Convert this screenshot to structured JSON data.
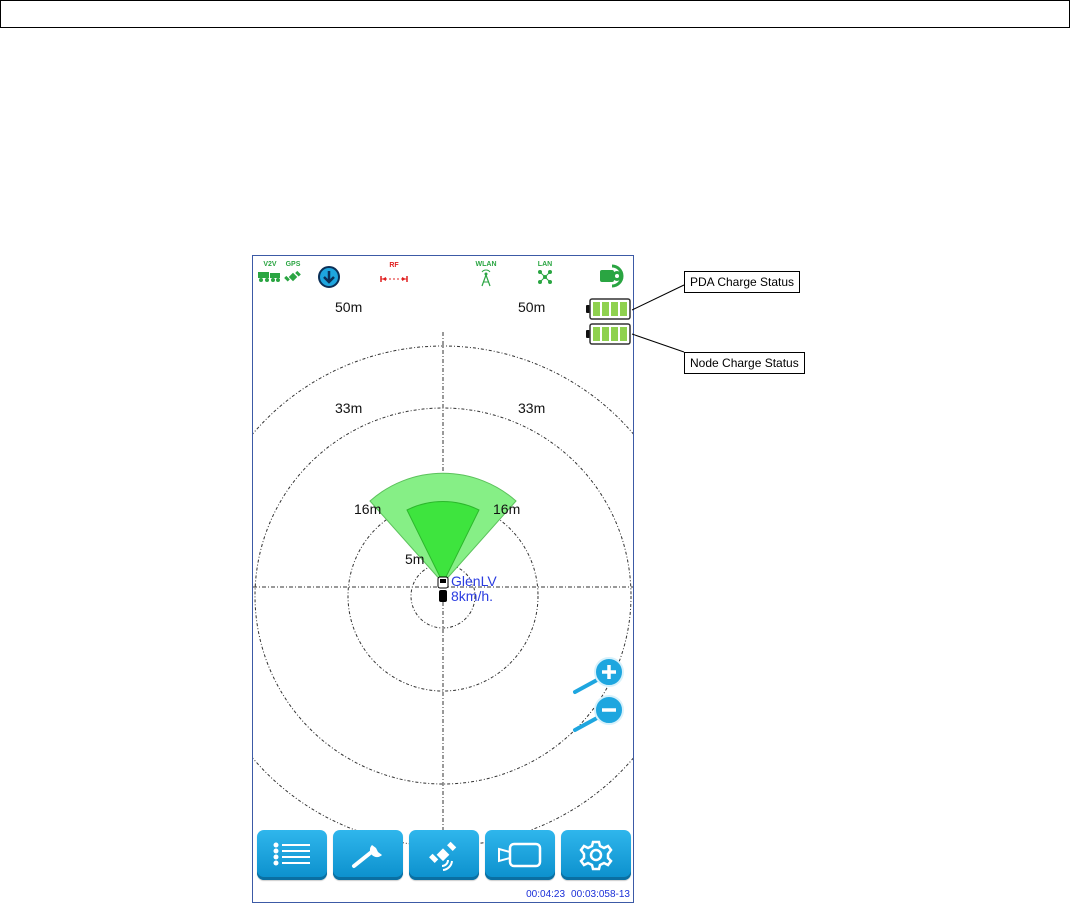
{
  "status_bar": {
    "v2v_label": "V2V",
    "gps_label": "GPS",
    "rf_label": "RF",
    "wlan_label": "WLAN",
    "lan_label": "LAN"
  },
  "radar": {
    "range_labels": {
      "outer_left": "50m",
      "outer_right": "50m",
      "r33_left": "33m",
      "r33_right": "33m",
      "r16_left": "16m",
      "r16_right": "16m",
      "r5": "5m"
    },
    "target": {
      "name": "GlenLV",
      "speed": "8km/h."
    }
  },
  "zoom": {
    "in_icon": "zoom-in-icon",
    "out_icon": "zoom-out-icon"
  },
  "toolbar": {
    "buttons": [
      {
        "icon": "list-icon"
      },
      {
        "icon": "wrench-icon"
      },
      {
        "icon": "satellite-icon"
      },
      {
        "icon": "camera-icon"
      },
      {
        "icon": "gear-icon"
      }
    ]
  },
  "footer": {
    "time_1": "00:04:23",
    "time_2": "00:03:058-13"
  },
  "annotations": {
    "pda_charge": "PDA Charge Status",
    "node_charge": "Node Charge Status"
  },
  "colors": {
    "accent_blue": "#1ea6df",
    "status_green": "#2aa542",
    "zone_green_light": "#86ef86",
    "zone_green_dark": "#3ee43e",
    "battery_green": "#8fd14f",
    "timestamp_blue": "#1a2fd8",
    "target_blue": "#2a3ce0"
  }
}
